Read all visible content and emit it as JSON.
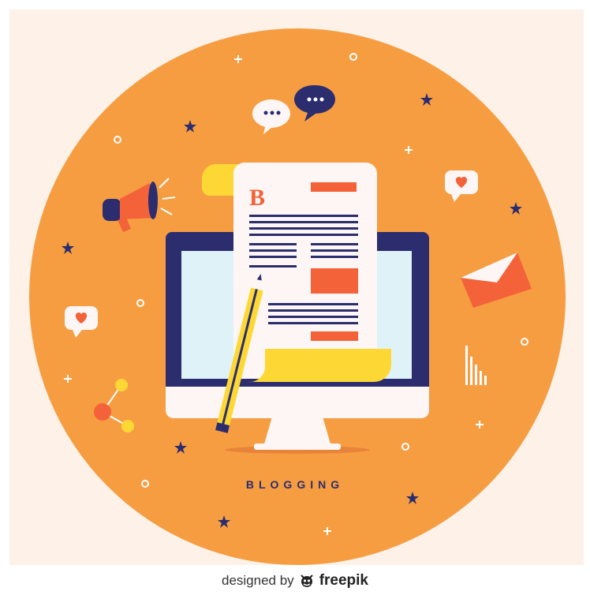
{
  "illustration": {
    "caption": "BLOGGING",
    "doc_initial": "B",
    "colors": {
      "background": "#fdf1e8",
      "circle": "#f69d42",
      "navy": "#2b2d6e",
      "accent_orange": "#f4623a",
      "yellow": "#fdd835",
      "screen": "#dff2f8",
      "paper": "#fdf6f4"
    }
  },
  "footer": {
    "prefix": "designed by",
    "brand": "freepik",
    "brand_icon": "freepik-logo-icon"
  }
}
